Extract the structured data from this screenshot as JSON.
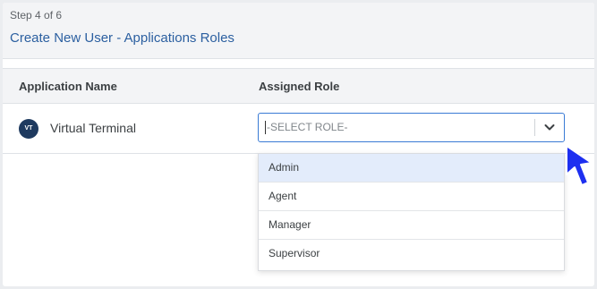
{
  "header": {
    "step": "Step 4 of 6",
    "title": "Create New User - Applications Roles"
  },
  "table": {
    "columns": [
      "Application Name",
      "Assigned Role"
    ],
    "rows": [
      {
        "avatar": "VT",
        "app_name": "Virtual Terminal",
        "role_placeholder": "-SELECT ROLE-"
      }
    ]
  },
  "dropdown": {
    "options": [
      "Admin",
      "Agent",
      "Manager",
      "Supervisor"
    ],
    "highlighted": "Admin"
  },
  "colors": {
    "title": "#2b5fa0",
    "select_border": "#3a7bd5",
    "highlight": "#e3ecfb",
    "avatar": "#1e3a5f",
    "cursor": "#1d2ff0"
  },
  "icons": {
    "select_chevron": "chevron-down-icon",
    "pointer": "mouse-pointer-icon"
  }
}
